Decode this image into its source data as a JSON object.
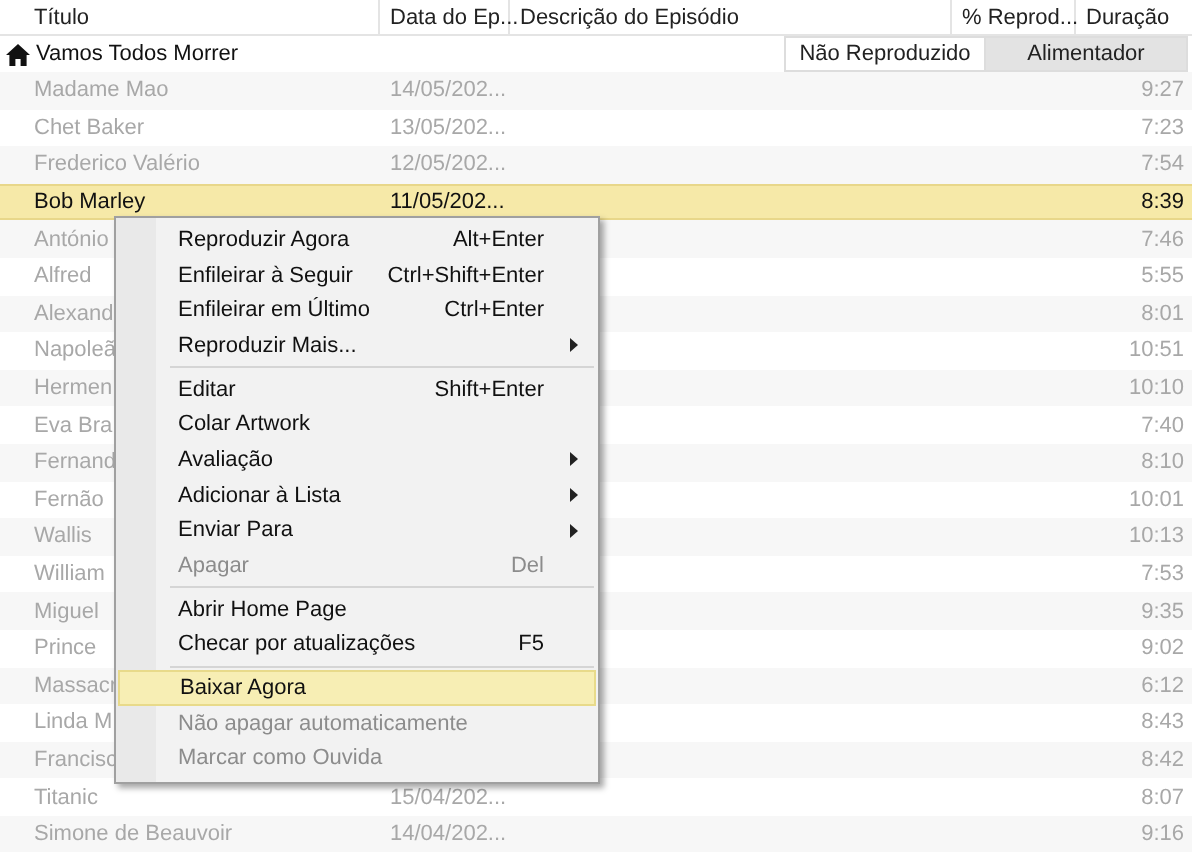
{
  "columns": [
    "Título",
    "Data do Ep...",
    "Descrição do Episódio",
    "% Reprod...",
    "Duração"
  ],
  "group": {
    "title": "Vamos Todos Morrer",
    "filters": [
      {
        "label": "Não Reproduzido",
        "selected": false
      },
      {
        "label": "Alimentador",
        "selected": true
      }
    ]
  },
  "rows": [
    {
      "title": "Madame Mao",
      "date": "14/05/202...",
      "duration": "9:27",
      "selected": false
    },
    {
      "title": "Chet Baker",
      "date": "13/05/202...",
      "duration": "7:23",
      "selected": false
    },
    {
      "title": "Frederico Valério",
      "date": "12/05/202...",
      "duration": "7:54",
      "selected": false
    },
    {
      "title": "Bob Marley",
      "date": "11/05/202...",
      "duration": "8:39",
      "selected": true
    },
    {
      "title": "António",
      "duration": "7:46",
      "selected": false
    },
    {
      "title": "Alfred",
      "duration": "5:55",
      "selected": false
    },
    {
      "title": "Alexand",
      "duration": "8:01",
      "selected": false
    },
    {
      "title": "Napoleã",
      "duration": "10:51",
      "selected": false
    },
    {
      "title": "Hermen",
      "duration": "10:10",
      "selected": false
    },
    {
      "title": "Eva Bra",
      "duration": "7:40",
      "selected": false
    },
    {
      "title": "Fernand",
      "duration": "8:10",
      "selected": false
    },
    {
      "title": "Fernão",
      "duration": "10:01",
      "selected": false
    },
    {
      "title": "Wallis",
      "duration": "10:13",
      "selected": false
    },
    {
      "title": "William",
      "duration": "7:53",
      "selected": false
    },
    {
      "title": "Miguel",
      "duration": "9:35",
      "selected": false
    },
    {
      "title": "Prince",
      "duration": "9:02",
      "selected": false
    },
    {
      "title": "Massacr",
      "duration": "6:12",
      "selected": false
    },
    {
      "title": "Linda M",
      "duration": "8:43",
      "selected": false
    },
    {
      "title": "Francisc",
      "duration": "8:42",
      "selected": false
    },
    {
      "title": "Titanic",
      "date": "15/04/202...",
      "duration": "8:07",
      "selected": false
    },
    {
      "title": "Simone de Beauvoir",
      "date": "14/04/202...",
      "duration": "9:16",
      "selected": false
    }
  ],
  "context_menu": [
    {
      "kind": "item",
      "label": "Reproduzir Agora",
      "shortcut": "Alt+Enter",
      "submenu": false,
      "disabled": false,
      "selected": false
    },
    {
      "kind": "item",
      "label": "Enfileirar à Seguir",
      "shortcut": "Ctrl+Shift+Enter",
      "submenu": false,
      "disabled": false,
      "selected": false
    },
    {
      "kind": "item",
      "label": "Enfileirar em Último",
      "shortcut": "Ctrl+Enter",
      "submenu": false,
      "disabled": false,
      "selected": false
    },
    {
      "kind": "item",
      "label": "Reproduzir Mais...",
      "submenu": true,
      "disabled": false,
      "selected": false
    },
    {
      "kind": "separator"
    },
    {
      "kind": "item",
      "label": "Editar",
      "shortcut": "Shift+Enter",
      "submenu": false,
      "disabled": false,
      "selected": false
    },
    {
      "kind": "item",
      "label": "Colar Artwork",
      "submenu": false,
      "disabled": false,
      "selected": false
    },
    {
      "kind": "item",
      "label": "Avaliação",
      "submenu": true,
      "disabled": false,
      "selected": false
    },
    {
      "kind": "item",
      "label": "Adicionar à Lista",
      "submenu": true,
      "disabled": false,
      "selected": false
    },
    {
      "kind": "item",
      "label": "Enviar Para",
      "submenu": true,
      "disabled": false,
      "selected": false
    },
    {
      "kind": "item",
      "label": "Apagar",
      "shortcut": "Del",
      "submenu": false,
      "disabled": true,
      "selected": false
    },
    {
      "kind": "separator"
    },
    {
      "kind": "item",
      "label": "Abrir Home Page",
      "submenu": false,
      "disabled": false,
      "selected": false
    },
    {
      "kind": "item",
      "label": "Checar por atualizações",
      "shortcut": "F5",
      "submenu": false,
      "disabled": false,
      "selected": false
    },
    {
      "kind": "separator"
    },
    {
      "kind": "item",
      "label": "Baixar Agora",
      "submenu": false,
      "disabled": false,
      "selected": true
    },
    {
      "kind": "item",
      "label": "Não apagar automaticamente",
      "submenu": false,
      "disabled": true,
      "selected": false
    },
    {
      "kind": "item",
      "label": "Marcar como Ouvida",
      "submenu": false,
      "disabled": true,
      "selected": false
    }
  ]
}
